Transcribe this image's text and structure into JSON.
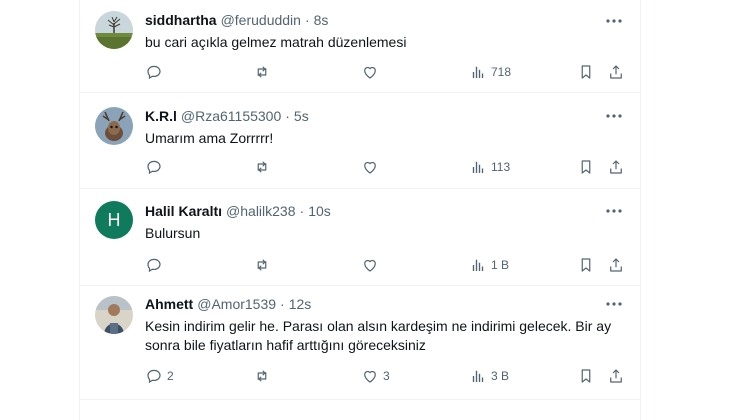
{
  "tweets": [
    {
      "name": "siddhartha",
      "handle": "@ferududdin",
      "dot": "·",
      "time": "8s",
      "text": "bu cari açıkla gelmez matrah düzenlemesi",
      "reply_count": "",
      "retweet_count": "",
      "like_count": "",
      "views": "718",
      "avatar": "landscape-photo"
    },
    {
      "name": "K.R.l",
      "handle": "@Rza61155300",
      "dot": "·",
      "time": "5s",
      "text": "Umarım ama Zorrrrr!",
      "reply_count": "",
      "retweet_count": "",
      "like_count": "",
      "views": "113",
      "avatar": "deer-photo"
    },
    {
      "name": "Halil Karaltı",
      "handle": "@halilk238",
      "dot": "·",
      "time": "10s",
      "text": "Bulursun",
      "reply_count": "",
      "retweet_count": "",
      "like_count": "",
      "views": "1 B",
      "avatar_letter": "H"
    },
    {
      "name": "Ahmett",
      "handle": "@Amor1539",
      "dot": "·",
      "time": "12s",
      "text": "Kesin indirim gelir he. Parası olan alsın kardeşim ne indirimi gelecek. Bir ay sonra bile fiyatların hafif arttığını göreceksiniz",
      "reply_count": "2",
      "retweet_count": "",
      "like_count": "3",
      "views": "3 B",
      "avatar": "person-photo"
    }
  ],
  "colors": {
    "text_primary": "#0f1419",
    "text_secondary": "#536471",
    "divider": "#eff3f4",
    "avatar_h_bg": "#0f7a5c"
  }
}
